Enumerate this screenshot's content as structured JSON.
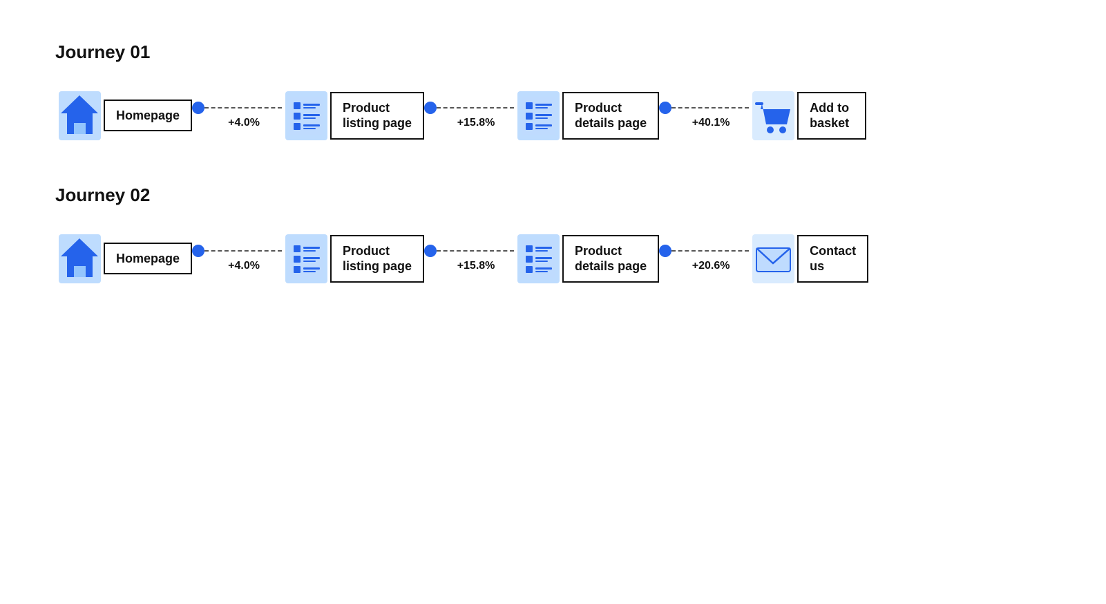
{
  "journeys": [
    {
      "id": "journey-01",
      "title": "Journey 01",
      "steps": [
        {
          "type": "home",
          "label": "Homepage"
        },
        {
          "connector": "+4.0%"
        },
        {
          "type": "listing",
          "label": "Product\nlisting page"
        },
        {
          "connector": "+15.8%"
        },
        {
          "type": "details",
          "label": "Product\ndetails page"
        },
        {
          "connector": "+40.1%"
        },
        {
          "type": "cart",
          "label": "Add to\nbasket"
        }
      ]
    },
    {
      "id": "journey-02",
      "title": "Journey 02",
      "steps": [
        {
          "type": "home",
          "label": "Homepage"
        },
        {
          "connector": "+4.0%"
        },
        {
          "type": "listing",
          "label": "Product\nlisting page"
        },
        {
          "connector": "+15.8%"
        },
        {
          "type": "details",
          "label": "Product\ndetails page"
        },
        {
          "connector": "+20.6%"
        },
        {
          "type": "contact",
          "label": "Contact\nus"
        }
      ]
    }
  ]
}
